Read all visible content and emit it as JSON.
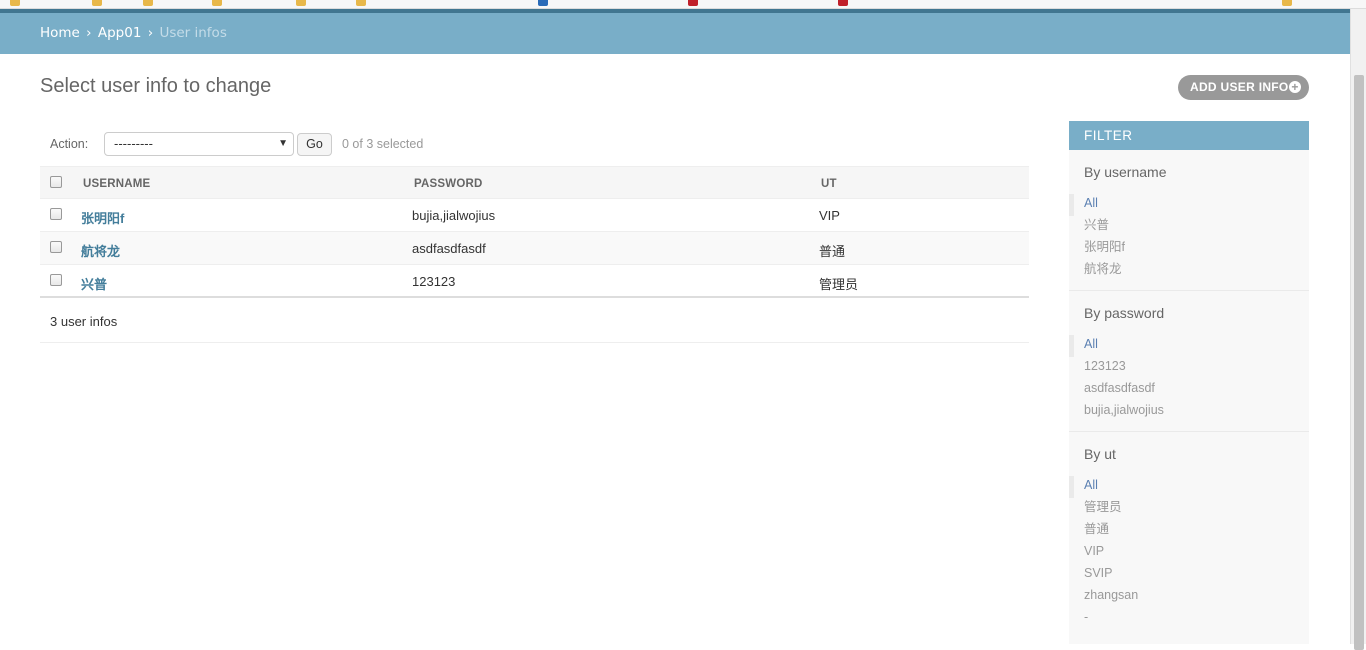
{
  "breadcrumbs": {
    "home": "Home",
    "sep1": "›",
    "app": "App01",
    "sep2": "›",
    "current": "User infos"
  },
  "page": {
    "title": "Select user info to change",
    "add_button": "ADD USER INFO",
    "add_icon": "+"
  },
  "actions": {
    "label": "Action:",
    "selected_option": "---------",
    "go_label": "Go",
    "counter": "0 of 3 selected"
  },
  "table": {
    "columns": [
      "USERNAME",
      "PASSWORD",
      "UT"
    ],
    "rows": [
      {
        "username": "张明阳f",
        "password": "bujia,jialwojius",
        "ut": "VIP"
      },
      {
        "username": "航将龙",
        "password": "asdfasdfasdf",
        "ut": "普通"
      },
      {
        "username": "兴普",
        "password": "123123",
        "ut": "管理员"
      }
    ]
  },
  "paginator": "3 user infos",
  "filter": {
    "title": "FILTER",
    "groups": [
      {
        "title": "By username",
        "options": [
          "All",
          "兴普",
          "张明阳f",
          "航将龙"
        ]
      },
      {
        "title": "By password",
        "options": [
          "All",
          "123123",
          "asdfasdfasdf",
          "bujia,jialwojius"
        ]
      },
      {
        "title": "By ut",
        "options": [
          "All",
          "管理员",
          "普通",
          "VIP",
          "SVIP",
          "zhangsan",
          "-"
        ]
      }
    ]
  },
  "colors": {
    "header": "#79aec8",
    "link": "#447e9b",
    "add_button": "#999999"
  }
}
